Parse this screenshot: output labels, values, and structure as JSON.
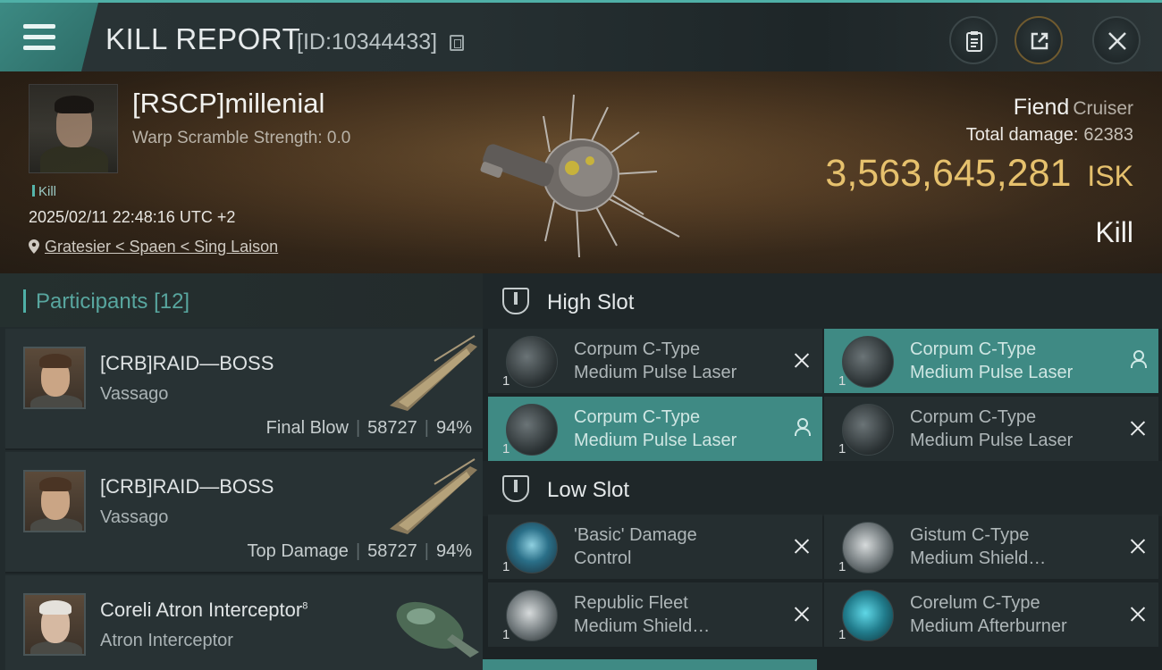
{
  "header": {
    "title": "KILL REPORT",
    "id_text": "[ID:10344433]"
  },
  "victim": {
    "name": "[RSCP]millenial",
    "warp": "Warp Scramble Strength: 0.0",
    "tag": "Kill",
    "datetime": "2025/02/11 22:48:16 UTC +2",
    "location": "Gratesier < Spaen < Sing Laison"
  },
  "summary": {
    "ship": "Fiend",
    "ship_class": "Cruiser",
    "total_damage_label": "Total damage:",
    "total_damage": "62383",
    "isk_value": "3,563,645,281",
    "isk_unit": "ISK",
    "result": "Kill"
  },
  "participants": {
    "label": "Participants",
    "count": "[12]",
    "rows": [
      {
        "name": "[CRB]RAID—BOSS",
        "ship": "Vassago",
        "role": "Final Blow",
        "damage": "58727",
        "percent": "94%"
      },
      {
        "name": "[CRB]RAID—BOSS",
        "ship": "Vassago",
        "role": "Top Damage",
        "damage": "58727",
        "percent": "94%"
      },
      {
        "name": "Coreli Atron Interceptor",
        "sup": "8",
        "ship": "Atron Interceptor",
        "role": "",
        "damage": "",
        "percent": ""
      }
    ]
  },
  "slots": {
    "high": {
      "label": "High Slot",
      "items": [
        {
          "line1": "Corpum C-Type",
          "line2": "Medium Pulse Laser",
          "qty": "1",
          "status": "destroyed"
        },
        {
          "line1": "Corpum C-Type",
          "line2": "Medium Pulse Laser",
          "qty": "1",
          "status": "dropped"
        },
        {
          "line1": "Corpum C-Type",
          "line2": "Medium Pulse Laser",
          "qty": "1",
          "status": "dropped"
        },
        {
          "line1": "Corpum C-Type",
          "line2": "Medium Pulse Laser",
          "qty": "1",
          "status": "destroyed"
        }
      ]
    },
    "low": {
      "label": "Low Slot",
      "items": [
        {
          "line1": "'Basic' Damage",
          "line2": "Control",
          "qty": "1",
          "status": "destroyed"
        },
        {
          "line1": "Gistum C-Type",
          "line2": "Medium Shield…",
          "qty": "1",
          "status": "destroyed"
        },
        {
          "line1": "Republic Fleet",
          "line2": "Medium Shield…",
          "qty": "1",
          "status": "destroyed"
        },
        {
          "line1": "Corelum C-Type",
          "line2": "Medium Afterburner",
          "qty": "1",
          "status": "destroyed"
        }
      ]
    }
  },
  "colors": {
    "accent": "#4fb0a7",
    "isk": "#e6c16d",
    "highlight": "#3f8a84"
  }
}
